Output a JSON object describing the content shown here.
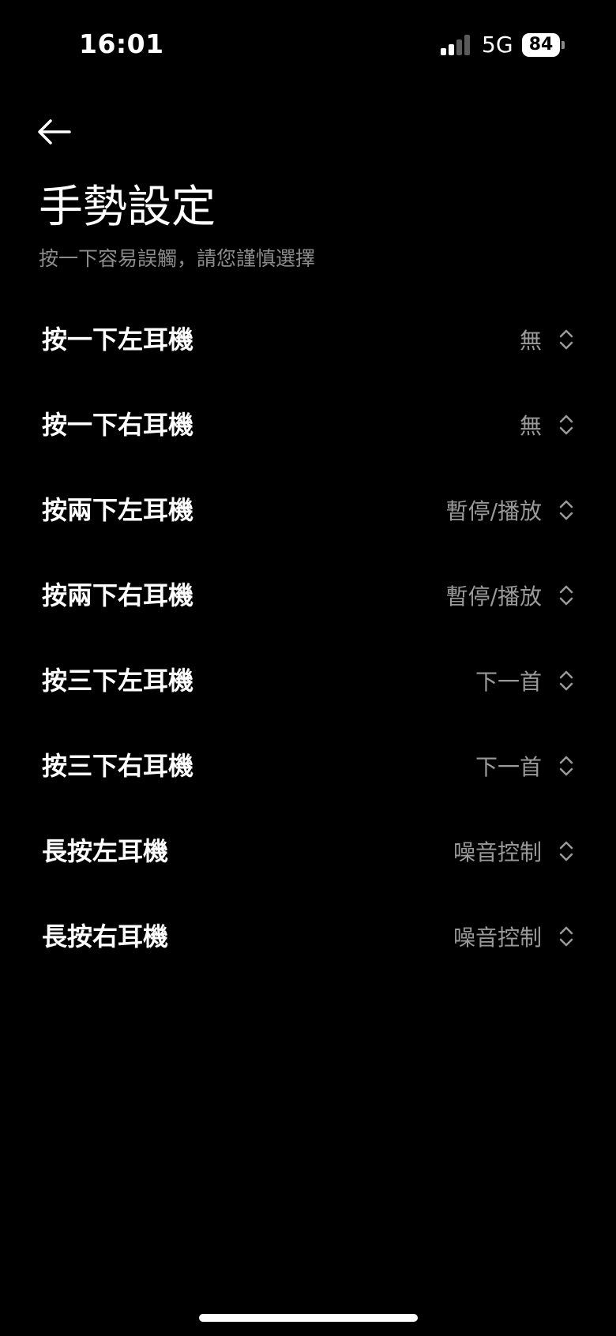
{
  "status_bar": {
    "time": "16:01",
    "network": "5G",
    "battery": "84",
    "icons": [
      "signal-bars-icon",
      "battery-icon"
    ]
  },
  "header": {
    "back_icon": "arrow-left-icon",
    "title": "手勢設定",
    "subtitle": "按一下容易誤觸，請您謹慎選擇"
  },
  "gestures": [
    {
      "label": "按一下左耳機",
      "value": "無"
    },
    {
      "label": "按一下右耳機",
      "value": "無"
    },
    {
      "label": "按兩下左耳機",
      "value": "暫停/播放"
    },
    {
      "label": "按兩下右耳機",
      "value": "暫停/播放"
    },
    {
      "label": "按三下左耳機",
      "value": "下一首"
    },
    {
      "label": "按三下右耳機",
      "value": "下一首"
    },
    {
      "label": "長按左耳機",
      "value": "噪音控制"
    },
    {
      "label": "長按右耳機",
      "value": "噪音控制"
    }
  ],
  "colors": {
    "background": "#000000",
    "primary_text": "#ffffff",
    "secondary_text": "#9a9a9a"
  }
}
